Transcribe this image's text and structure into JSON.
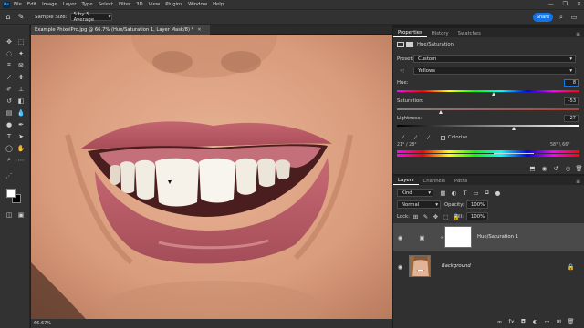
{
  "menubar": {
    "logo": "Ps",
    "items": [
      "File",
      "Edit",
      "Image",
      "Layer",
      "Type",
      "Select",
      "Filter",
      "3D",
      "View",
      "Plugins",
      "Window",
      "Help"
    ],
    "minimize": "—",
    "maximize": "❐",
    "close": "✕"
  },
  "options": {
    "sample_label": "Sample Size:",
    "sample_value": "5 by 5 Average",
    "share_label": "Share"
  },
  "document": {
    "tab_title": "Example PhixelPro.jpg @ 66.7% (Hue/Saturation 1, Layer Mask/8) *",
    "zoom": "66.67%"
  },
  "properties": {
    "tabs": [
      "Properties",
      "History",
      "Swatches"
    ],
    "title": "Hue/Saturation",
    "preset_label": "Preset:",
    "preset_value": "Custom",
    "channel_value": "Yellows",
    "hue_label": "Hue:",
    "hue_value": "8",
    "hue_fraction": 0.53,
    "saturation_label": "Saturation:",
    "saturation_value": "-53",
    "saturation_fraction": 0.24,
    "lightness_label": "Lightness:",
    "lightness_value": "+27",
    "lightness_fraction": 0.64,
    "colorize_label": "Colorize",
    "range_left": "21° / 28°",
    "range_right": "58° \\ 66°"
  },
  "layers": {
    "tabs": [
      "Layers",
      "Channels",
      "Paths"
    ],
    "filter_kind": "Kind",
    "blend_mode": "Normal",
    "opacity_label": "Opacity:",
    "opacity_value": "100%",
    "lock_label": "Lock:",
    "fill_label": "Fill:",
    "fill_value": "100%",
    "items": [
      {
        "name": "Hue/Saturation 1"
      },
      {
        "name": "Background"
      }
    ]
  },
  "colors": {
    "accent": "#1473e6",
    "panel_bg": "#303030",
    "selected_layer": "#4a4a4a"
  }
}
